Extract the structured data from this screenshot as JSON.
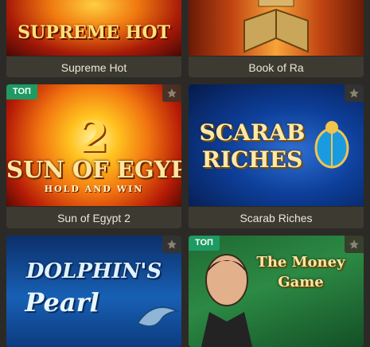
{
  "games": [
    {
      "id": "supreme-hot",
      "name": "Supreme Hot",
      "art_text": "SUPREME HOT",
      "badge": "",
      "favorite_icon": "star-icon"
    },
    {
      "id": "book-of-ra",
      "name": "Book of Ra",
      "art_text": "",
      "badge": "",
      "favorite_icon": "star-icon"
    },
    {
      "id": "sun-of-egypt-2",
      "name": "Sun of Egypt 2",
      "art_text": "SUN OF EGYPT",
      "art_number": "2",
      "art_small": "OF",
      "art_sub": "HOLD AND WIN",
      "badge": "ТОП",
      "favorite_icon": "star-icon"
    },
    {
      "id": "scarab-riches",
      "name": "Scarab Riches",
      "art_text": "SCARAB",
      "art_text2": "RICHES",
      "badge": "",
      "favorite_icon": "star-icon"
    },
    {
      "id": "dolphins-pearl",
      "name": "Dolphin's Pearl",
      "art_text": "DOLPHIN'S",
      "art_text2": "Pearl",
      "badge": "",
      "favorite_icon": "star-icon"
    },
    {
      "id": "the-money-game",
      "name": "The Money Game",
      "art_text": "The Money",
      "art_text2": "Game",
      "badge": "ТОП",
      "favorite_icon": "star-icon"
    }
  ],
  "colors": {
    "badge": "#1e9a63",
    "caption_bg": "#3d3a31",
    "page_bg": "#2c2a26"
  }
}
